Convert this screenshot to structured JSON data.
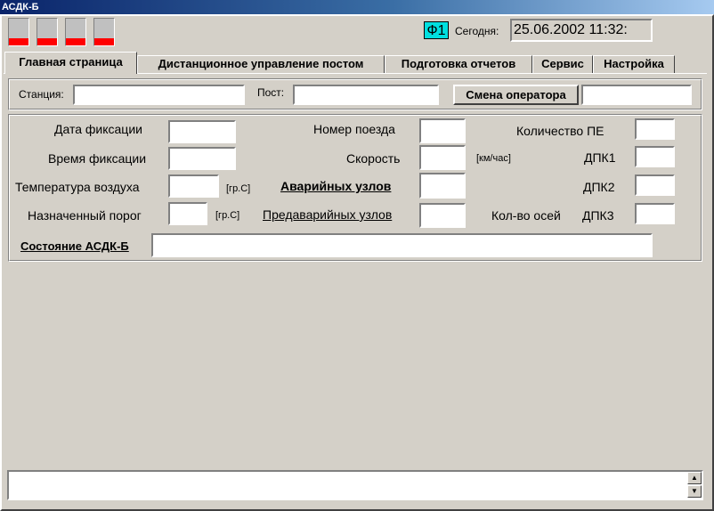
{
  "window": {
    "title": "АСДК-Б"
  },
  "indicators": [
    {
      "name": "indicator-1",
      "status_color": "#ff0000"
    },
    {
      "name": "indicator-2",
      "status_color": "#ff0000"
    },
    {
      "name": "indicator-3",
      "status_color": "#ff0000"
    },
    {
      "name": "indicator-4",
      "status_color": "#ff0000"
    }
  ],
  "header": {
    "f1_label": "Ф1",
    "today_label": "Сегодня:",
    "datetime": "25.06.2002 11:32:"
  },
  "tabs": [
    {
      "label": "Главная страница",
      "active": true
    },
    {
      "label": "Дистанционное управление постом",
      "active": false
    },
    {
      "label": "Подготовка отчетов",
      "active": false
    },
    {
      "label": "Сервис",
      "active": false
    },
    {
      "label": "Настройка",
      "active": false
    }
  ],
  "station_row": {
    "station_label": "Станция:",
    "station_value": "",
    "post_label": "Пост:",
    "post_value": "",
    "change_operator_label": "Смена оператора",
    "operator_value": ""
  },
  "fields": {
    "fix_date_label": "Дата фиксации",
    "fix_time_label": "Время фиксации",
    "air_temp_label": "Температура воздуха",
    "air_temp_unit": "[гр.С]",
    "threshold_label": "Назначенный порог",
    "threshold_unit": "[гр.С]",
    "train_number_label": "Номер поезда",
    "speed_label": "Скорость",
    "speed_unit": "[км/час]",
    "emergency_nodes_label": "Аварийных узлов",
    "pre_emergency_nodes_label": "Предаварийных узлов",
    "pe_count_label": "Количество ПЕ",
    "dpk1_label": "ДПК1",
    "dpk2_label": "ДПК2",
    "axle_count_label": "Кол-во осей",
    "dpk3_label": "ДПК3",
    "status_label": "Состояние АСДК-Б"
  },
  "colors": {
    "accent_cyan": "#00e0e0",
    "alarm_red": "#ff0000",
    "face": "#d4d0c8"
  }
}
